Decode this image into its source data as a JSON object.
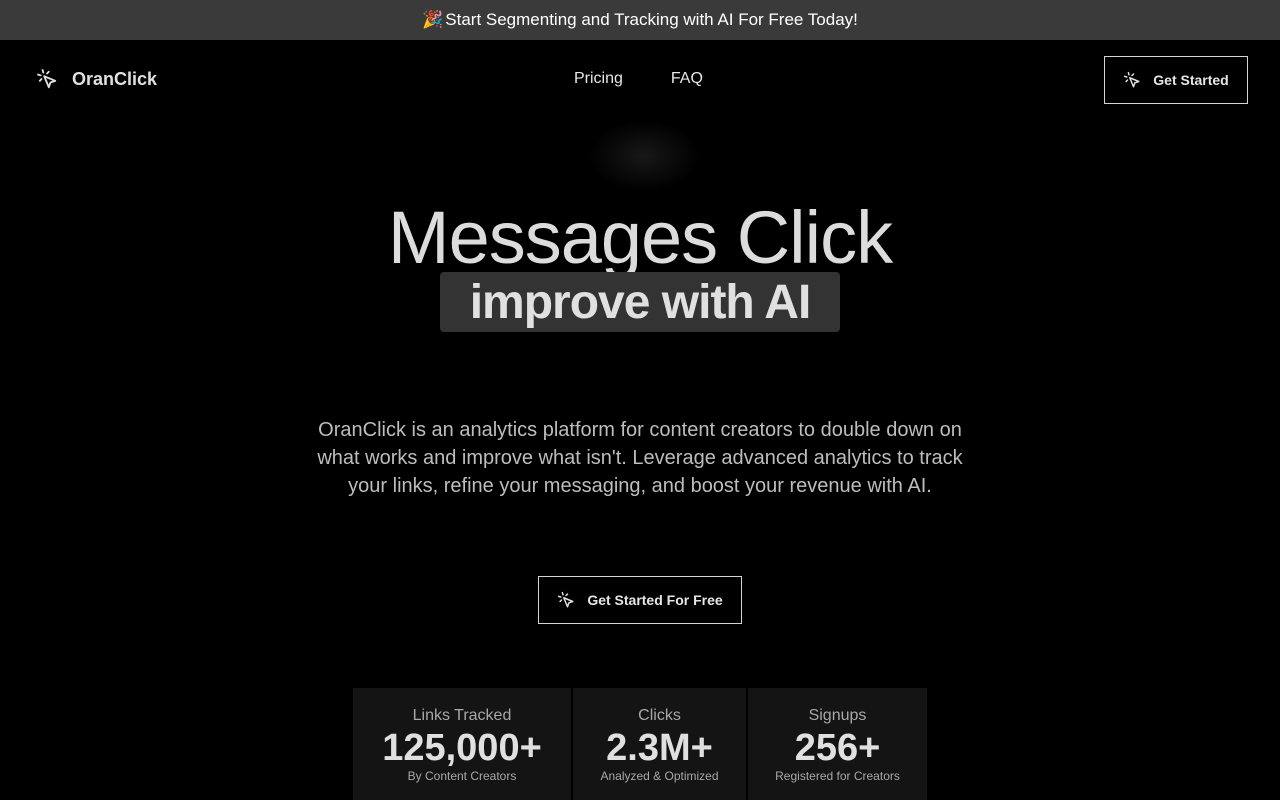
{
  "banner": {
    "emoji": "🎉",
    "text": "Start Segmenting and Tracking with AI For Free Today!"
  },
  "nav": {
    "logo_text": "OranClick",
    "links": [
      "Pricing",
      "FAQ"
    ],
    "cta_label": "Get Started"
  },
  "hero": {
    "title": "Messages Click",
    "highlight": "improve with AI",
    "description": "OranClick is an analytics platform for content creators to double down on what works and improve what isn't. Leverage advanced analytics to track your links, refine your messaging, and boost your revenue with AI.",
    "cta_label": "Get Started For Free"
  },
  "stats": [
    {
      "label": "Links Tracked",
      "value": "125,000+",
      "sub": "By Content Creators"
    },
    {
      "label": "Clicks",
      "value": "2.3M+",
      "sub": "Analyzed & Optimized"
    },
    {
      "label": "Signups",
      "value": "256+",
      "sub": "Registered for Creators"
    }
  ],
  "icons": {
    "cursor": "cursor-click-icon",
    "party": "party-popper-icon"
  }
}
